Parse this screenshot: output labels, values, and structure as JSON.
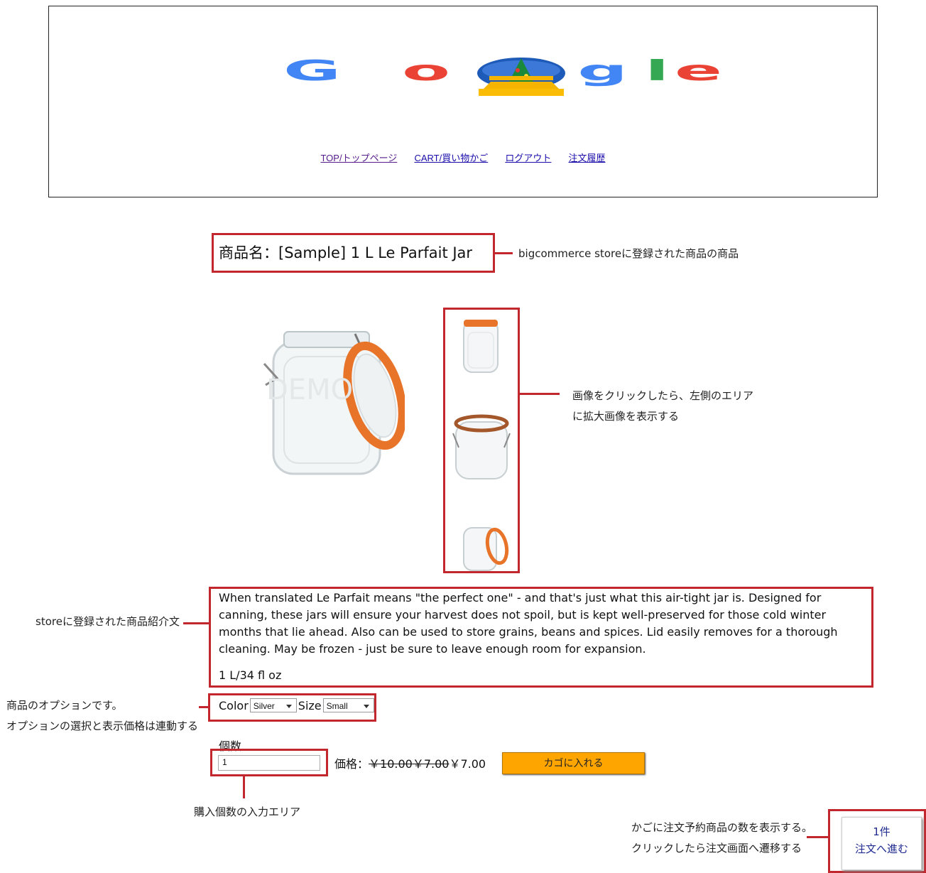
{
  "header": {
    "logo_letters": [
      "G",
      "o",
      "o",
      "g",
      "l",
      "e"
    ],
    "nav": [
      {
        "label": "TOP/トップページ"
      },
      {
        "label": "CART/買い物かご"
      },
      {
        "label": "ログアウト"
      },
      {
        "label": "注文履歴"
      }
    ]
  },
  "product": {
    "title": "商品名：[Sample] 1 L Le Parfait Jar",
    "description": "When translated Le Parfait means \"the perfect one\" - and that's just what this air-tight jar is. Designed for canning, these jars will ensure your harvest does not spoil, but is kept well-preserved for those cold winter months that lie ahead. Also can be used to store grains, beans and spices. Lid easily removes for a thorough cleaning. May be frozen - just be sure to leave enough room for expansion.",
    "size_note": "1 L/34 fl oz",
    "main_image_watermark": "DEMO",
    "options": {
      "color_label": "Color",
      "color_value": "Silver",
      "size_label": "Size",
      "size_value": "Small"
    },
    "quantity_label": "個数",
    "quantity_value": "1",
    "price_label": "価格：",
    "price_old1": "￥10.00",
    "price_old2": "￥7.00",
    "price_current": "￥7.00",
    "add_to_cart": "カゴに入れる"
  },
  "order": {
    "count": "1件",
    "label": "注文へ進む"
  },
  "annotations": {
    "title_note": "bigcommerce storeに登録された商品の商品",
    "thumbs_note_1": "画像をクリックしたら、左側のエリア",
    "thumbs_note_2": "に拡大画像を表示する",
    "desc_note": "storeに登録された商品紹介文",
    "options_note_1": "商品のオプションです。",
    "options_note_2": "オプションの選択と表示価格は連動する",
    "qty_note": "購入個数の入力エリア",
    "order_note_1": "かごに注文予約商品の数を表示する。",
    "order_note_2": "クリックしたら注文画面へ遷移する"
  },
  "colors": {
    "annotation_red": "#c1272d",
    "cart_button": "#ffa500",
    "jar_lid_orange": "#e8742a",
    "link": "#1a0dab"
  }
}
